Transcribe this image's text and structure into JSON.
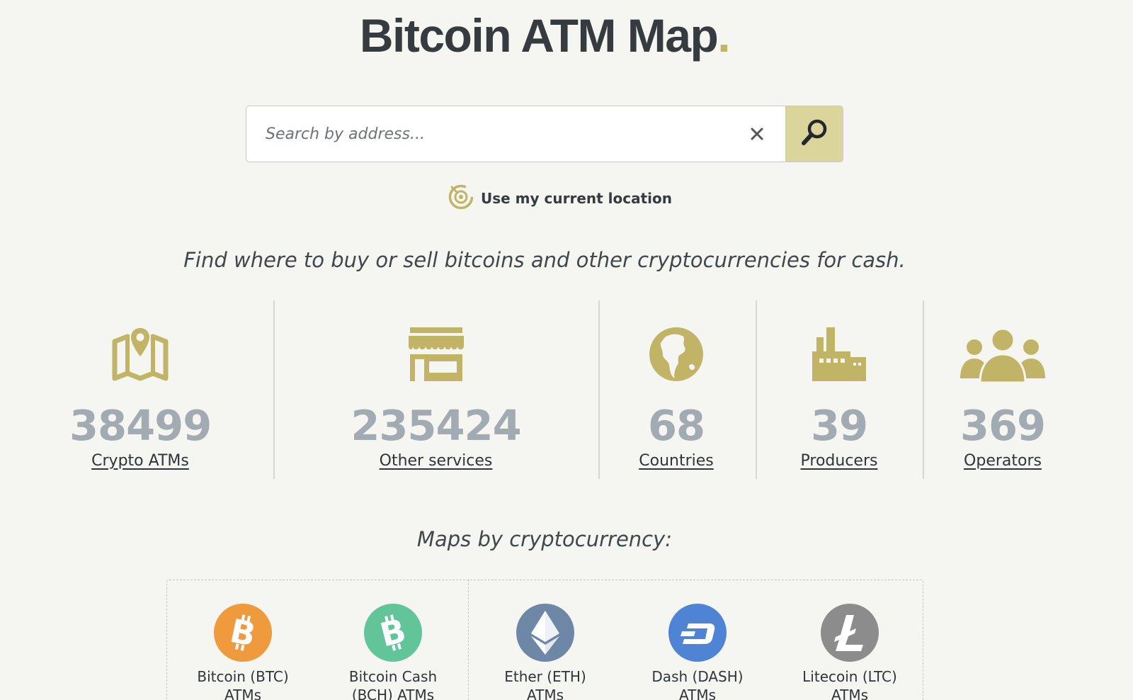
{
  "header": {
    "logo_text": "Bitcoin ATM Map",
    "logo_dot": "."
  },
  "search": {
    "placeholder": "Search by address...",
    "value": "",
    "clear_icon": "close-icon",
    "submit_icon": "search-icon"
  },
  "location": {
    "label": "Use my current location",
    "icon": "locate-icon"
  },
  "tagline": "Find where to buy or sell bitcoins and other cryptocurrencies for cash.",
  "stats": [
    {
      "value": "38499",
      "label": "Crypto ATMs",
      "icon": "map-pin-icon"
    },
    {
      "value": "235424",
      "label": "Other services",
      "icon": "storefront-icon"
    },
    {
      "value": "68",
      "label": "Countries",
      "icon": "globe-icon"
    },
    {
      "value": "39",
      "label": "Producers",
      "icon": "factory-icon"
    },
    {
      "value": "369",
      "label": "Operators",
      "icon": "people-icon"
    }
  ],
  "maps_title": "Maps by cryptocurrency:",
  "coins": [
    {
      "label": "Bitcoin (BTC)\nATMs",
      "icon": "bitcoin-icon",
      "color": "#ef9a3d"
    },
    {
      "label": "Bitcoin Cash\n(BCH) ATMs",
      "icon": "bitcoin-cash-icon",
      "color": "#62c59a"
    },
    {
      "label": "Ether (ETH)\nATMs",
      "icon": "ethereum-icon",
      "color": "#6f87a6"
    },
    {
      "label": "Dash (DASH)\nATMs",
      "icon": "dash-icon",
      "color": "#4f83d4"
    },
    {
      "label": "Litecoin (LTC)\nATMs",
      "icon": "litecoin-icon",
      "color": "#8c8c8c"
    }
  ],
  "colors": {
    "accent": "#c2b467",
    "stat_value": "#a2abb1",
    "search_button": "#dbd49b",
    "background": "#f5f5f1"
  }
}
